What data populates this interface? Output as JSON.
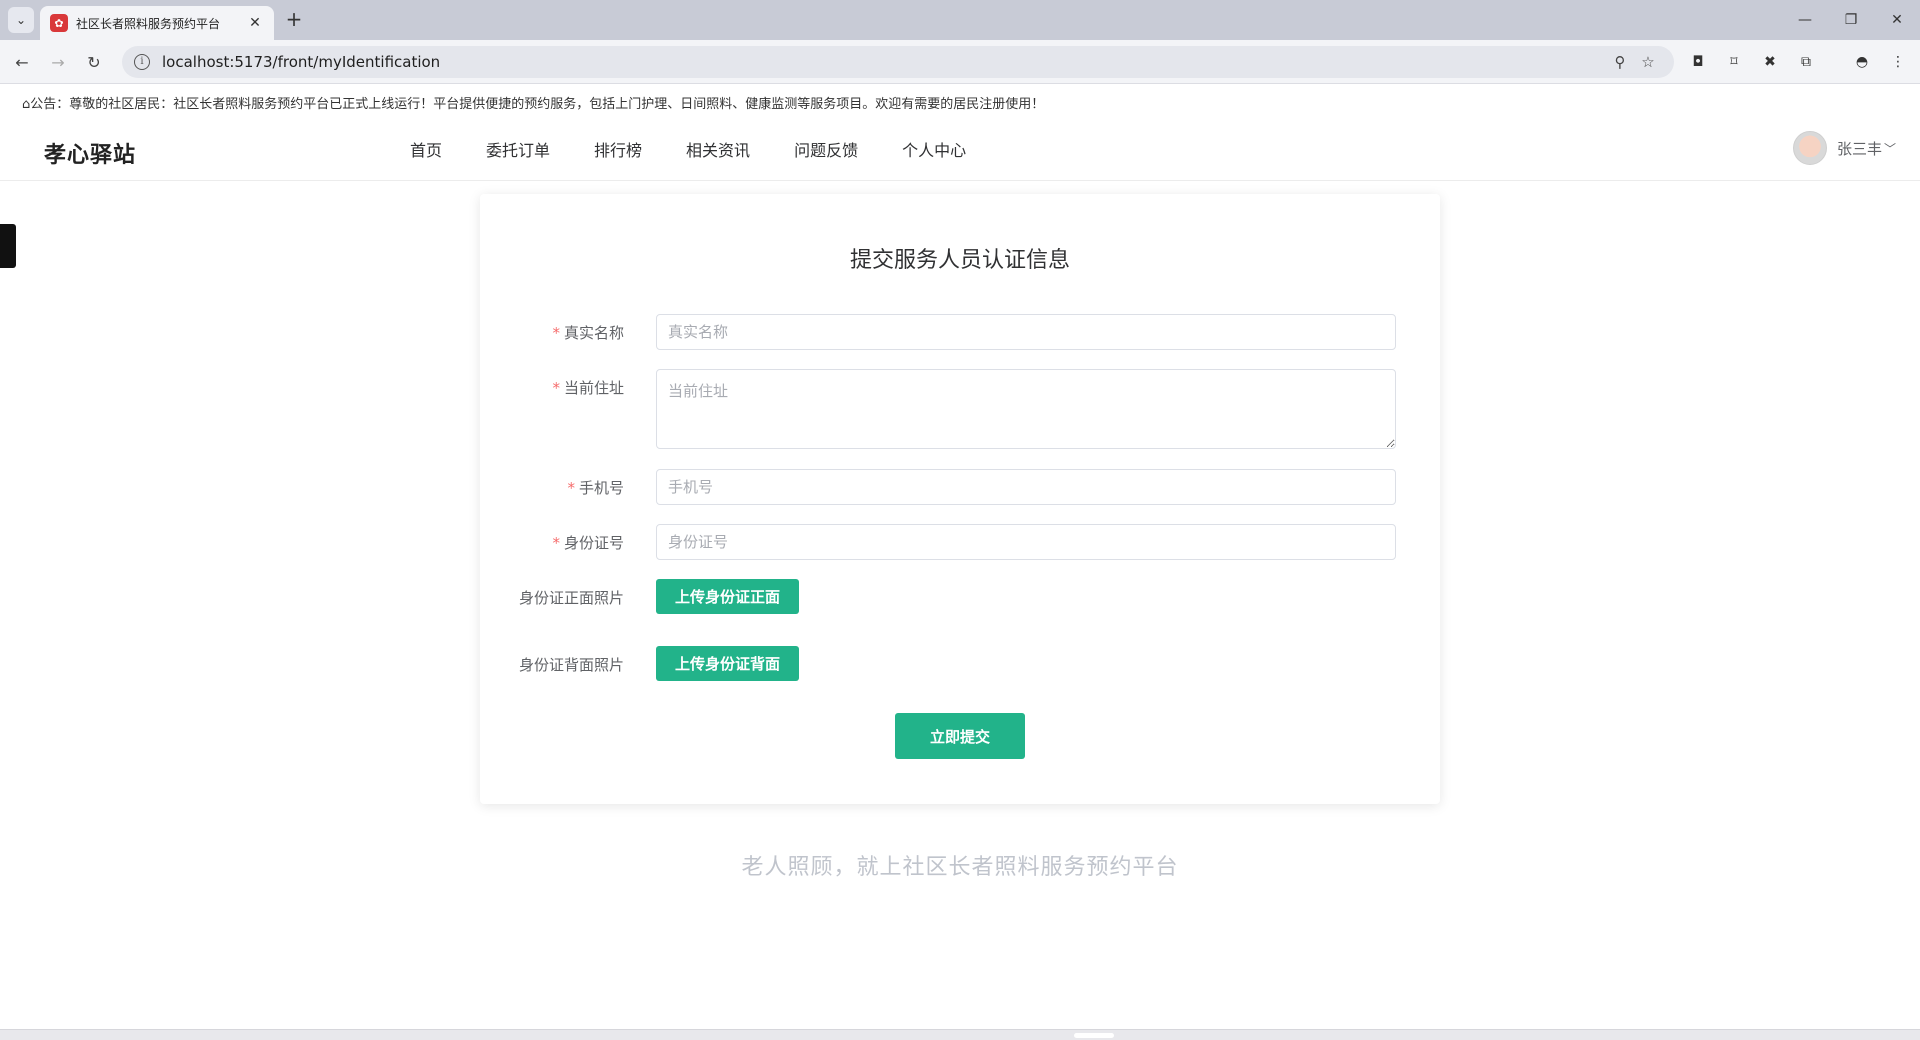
{
  "browser": {
    "tab_title": "社区长者照料服务预约平台",
    "tab_favicon_icon": "app-logo-icon",
    "url": "localhost:5173/front/myIdentification"
  },
  "notice": {
    "text": "公告：尊敬的社区居民：社区长者照料服务预约平台已正式上线运行！平台提供便捷的预约服务，包括上门护理、日间照料、健康监测等服务项目。欢迎有需要的居民注册使用！"
  },
  "header": {
    "logo": "孝心驿站",
    "nav": [
      "首页",
      "委托订单",
      "排行榜",
      "相关资讯",
      "问题反馈",
      "个人中心"
    ],
    "user_name": "张三丰"
  },
  "form": {
    "title": "提交服务人员认证信息",
    "real_name": {
      "label": "真实名称",
      "placeholder": "真实名称",
      "value": "",
      "required": true
    },
    "address": {
      "label": "当前住址",
      "placeholder": "当前住址",
      "value": "",
      "required": true
    },
    "phone": {
      "label": "手机号",
      "placeholder": "手机号",
      "value": "",
      "required": true
    },
    "id_number": {
      "label": "身份证号",
      "placeholder": "身份证号",
      "value": "",
      "required": true
    },
    "id_front": {
      "label": "身份证正面照片",
      "button": "上传身份证正面"
    },
    "id_back": {
      "label": "身份证背面照片",
      "button": "上传身份证背面"
    },
    "submit": "立即提交",
    "required_mark": "*"
  },
  "footer": {
    "slogan": "老人照顾，就上社区长者照料服务预约平台"
  },
  "colors": {
    "accent": "#22b38a",
    "required": "#f56c6c"
  }
}
